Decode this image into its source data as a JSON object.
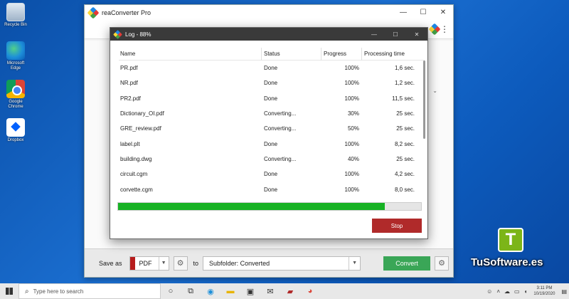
{
  "desktop": {
    "icons": [
      {
        "label": "Recycle Bin"
      },
      {
        "label": "Microsoft Edge"
      },
      {
        "label": "Google Chrome"
      },
      {
        "label": "Dropbox"
      }
    ]
  },
  "app": {
    "title": "reaConverter Pro",
    "window_controls": [
      "—",
      "☐",
      "✕"
    ]
  },
  "log": {
    "title": "Log - 88%",
    "window_controls": [
      "—",
      "☐",
      "✕"
    ],
    "columns": [
      "Name",
      "Status",
      "Progress",
      "Processing time"
    ],
    "rows": [
      {
        "name": "PR.pdf",
        "status": "Done",
        "progress": "100%",
        "time": "1,6 sec."
      },
      {
        "name": "NR.pdf",
        "status": "Done",
        "progress": "100%",
        "time": "1,2 sec."
      },
      {
        "name": "PR2.pdf",
        "status": "Done",
        "progress": "100%",
        "time": "11,5 sec."
      },
      {
        "name": "Dictionary_OI.pdf",
        "status": "Converting...",
        "progress": "30%",
        "time": "25 sec."
      },
      {
        "name": "GRE_review.pdf",
        "status": "Converting...",
        "progress": "50%",
        "time": "25 sec."
      },
      {
        "name": "label.plt",
        "status": "Done",
        "progress": "100%",
        "time": "8,2 sec."
      },
      {
        "name": "building.dwg",
        "status": "Converting...",
        "progress": "40%",
        "time": "25 sec."
      },
      {
        "name": "circuit.cgm",
        "status": "Done",
        "progress": "100%",
        "time": "4,2 sec."
      },
      {
        "name": "corvette.cgm",
        "status": "Done",
        "progress": "100%",
        "time": "8,0 sec."
      }
    ],
    "overall_progress": 0.88,
    "stop_label": "Stop"
  },
  "bottombar": {
    "save_as_label": "Save as",
    "format_value": "PDF",
    "to_label": "to",
    "destination_value": "Subfolder: Converted",
    "convert_label": "Convert"
  },
  "watermark": {
    "logo_letter": "T",
    "text": "TuSoftware.es"
  },
  "taskbar": {
    "search_placeholder": "Type here to search",
    "time": "3:11 PM",
    "date": "10/19/2020"
  },
  "colors": {
    "accent_convert": "#3aa657",
    "stop": "#b02a2a",
    "progress": "#17b224"
  }
}
